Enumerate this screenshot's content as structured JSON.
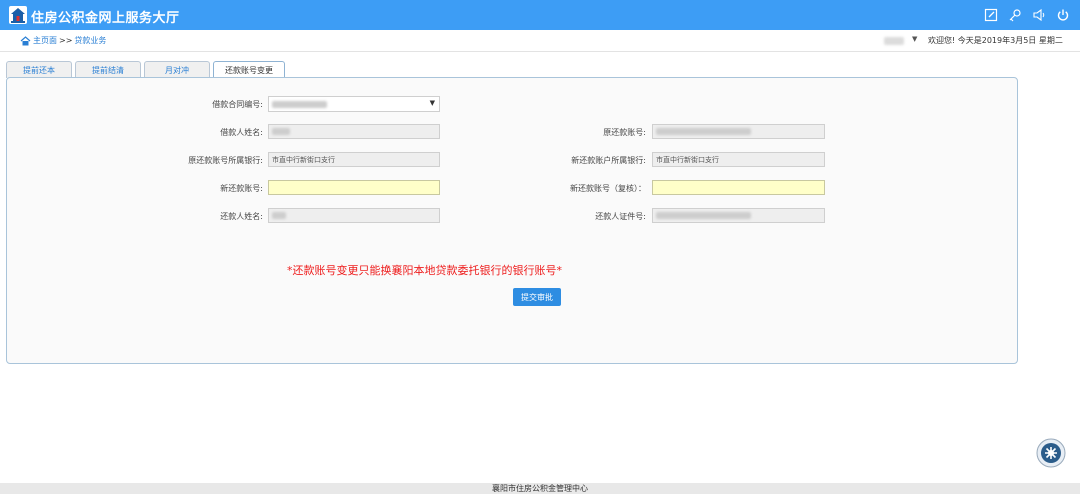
{
  "header": {
    "title": "住房公积金网上服务大厅",
    "icons": [
      "edit-icon",
      "key-icon",
      "sound-icon",
      "power-icon"
    ]
  },
  "breadcrumb": {
    "home": "主页面",
    "separator": ">>",
    "current": "贷款业务"
  },
  "user_bar": {
    "welcome": "欢迎您!  今天是2019年3月5日 星期二"
  },
  "tabs": [
    {
      "label": "提前还本"
    },
    {
      "label": "提前结清"
    },
    {
      "label": "月对冲"
    },
    {
      "label": "还款账号变更",
      "active": true
    }
  ],
  "form": {
    "contract_no_label": "借款合同编号:",
    "borrower_name_label": "借款人姓名:",
    "orig_account_label": "原还款账号:",
    "orig_bank_label": "原还款账号所属银行:",
    "orig_bank_value": "市直中行新街口支行",
    "new_bank_label": "新还款账户所属银行:",
    "new_bank_value": "市直中行新街口支行",
    "new_account_label": "新还款账号:",
    "new_account_value": "",
    "new_account_confirm_label": "新还款账号（复核）：",
    "new_account_confirm_value": "",
    "repayer_name_label": "还款人姓名:",
    "repayer_id_label": "还款人证件号:"
  },
  "warning": "*还款账号变更只能换襄阳本地贷款委托银行的银行账号*",
  "submit_label": "提交审批",
  "footer": "襄阳市住房公积金管理中心",
  "colors": {
    "header_bg": "#3d9df5",
    "warning": "#ee1d1d",
    "button": "#2e8de2",
    "highlight_field": "#ffffc9"
  }
}
